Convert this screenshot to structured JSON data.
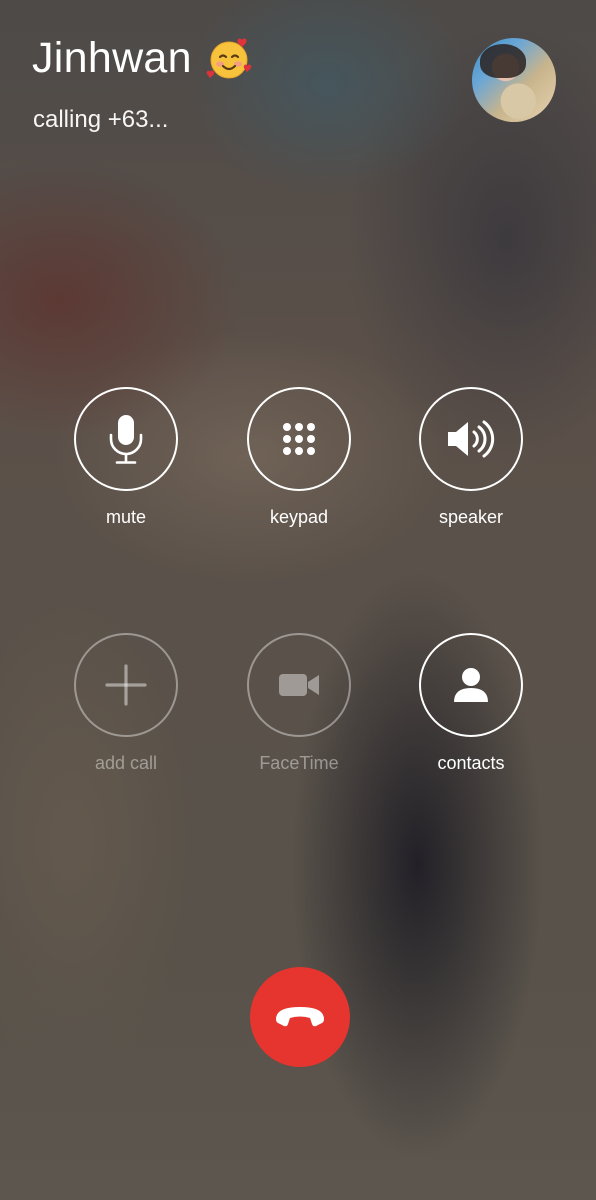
{
  "caller": {
    "name": "Jinhwan",
    "emoji_icon": "smiling-face-with-hearts-icon",
    "status": "calling +63...",
    "avatar_icon": "contact-photo"
  },
  "controls": [
    {
      "label": "mute",
      "icon": "microphone-icon",
      "enabled": true
    },
    {
      "label": "keypad",
      "icon": "keypad-icon",
      "enabled": true
    },
    {
      "label": "speaker",
      "icon": "speaker-icon",
      "enabled": true
    },
    {
      "label": "add call",
      "icon": "plus-icon",
      "enabled": false
    },
    {
      "label": "FaceTime",
      "icon": "video-camera-icon",
      "enabled": false
    },
    {
      "label": "contacts",
      "icon": "person-icon",
      "enabled": true
    }
  ],
  "end_call": {
    "icon": "phone-hangup-icon",
    "color": "#e5352e"
  },
  "colors": {
    "text": "#ffffff",
    "disabled": "rgba(255,255,255,0.4)",
    "end_call_red": "#e5352e"
  }
}
